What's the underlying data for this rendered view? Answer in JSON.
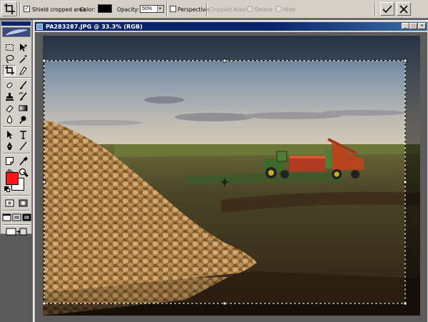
{
  "options_bar": {
    "shield_label": "Shield cropped area",
    "shield_checked": true,
    "color_label": "Color:",
    "shield_color": "#000000",
    "opacity_label": "Opacity:",
    "opacity_value": "50%",
    "perspective_label": "Perspective",
    "perspective_checked": false,
    "cropped_area_label": "Cropped Area:",
    "delete_label": "Delete",
    "hide_label": "Hide",
    "commit_icon": "checkmark-icon",
    "cancel_icon": "cancel-x-icon"
  },
  "toolbox": {
    "tools": [
      "marquee",
      "move",
      "lasso",
      "magic-wand",
      "crop",
      "slice",
      "healing-brush",
      "brush",
      "clone-stamp",
      "history-brush",
      "eraser",
      "gradient",
      "blur",
      "dodge",
      "path-selection",
      "type",
      "pen",
      "line",
      "notes",
      "eyedropper",
      "hand",
      "zoom"
    ],
    "selected_tool": "crop",
    "foreground_color": "#ff1414",
    "background_color": "#ffffff"
  },
  "document": {
    "title": "PA283287.JPG @ 33.3% (RGB)",
    "zoom": "33.3%",
    "mode": "RGB",
    "window_buttons": {
      "minimize": "_",
      "maximize": "□",
      "close": "×"
    }
  }
}
